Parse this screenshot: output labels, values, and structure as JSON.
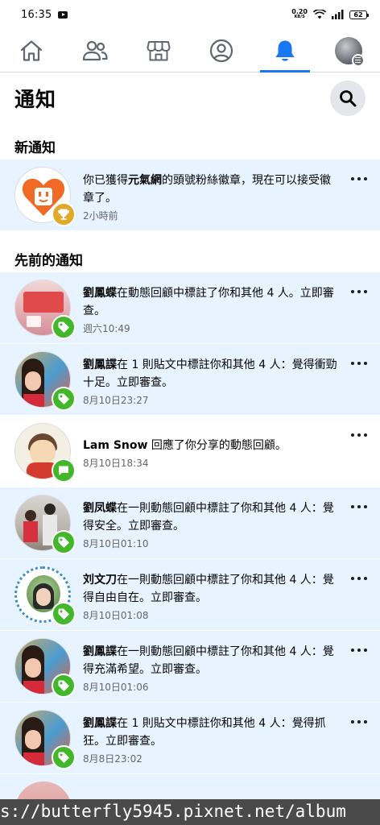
{
  "status_bar": {
    "time": "16:35",
    "net_speed": "0.20",
    "net_unit": "KB/S",
    "battery": "62"
  },
  "tabs": [
    {
      "name": "home",
      "icon": "home-icon",
      "active": false
    },
    {
      "name": "friends",
      "icon": "friends-icon",
      "active": false
    },
    {
      "name": "marketplace",
      "icon": "store-icon",
      "active": false
    },
    {
      "name": "profile",
      "icon": "profile-icon",
      "active": false
    },
    {
      "name": "notifications",
      "icon": "bell-icon",
      "active": true
    },
    {
      "name": "menu",
      "icon": "menu-avatar-icon",
      "active": false
    }
  ],
  "colors": {
    "accent": "#1877f2",
    "unread_bg": "#e7f3ff",
    "badge_green": "#42b72a",
    "badge_gold": "#e1a82a",
    "secondary_text": "#65676b"
  },
  "header": {
    "title": "通知"
  },
  "sections": {
    "new": "新通知",
    "earlier": "先前的通知"
  },
  "notifications": [
    {
      "pre": "你已獲得",
      "bold": "元氣網",
      "post": "的頭號粉絲徽章，現在可以接受徽章了。",
      "time": "2小時前",
      "badge": "trophy-icon",
      "unread": true
    },
    {
      "pre": "",
      "bold": "劉鳳蝶",
      "post": "在動態回顧中標註了你和其他 4 人。立即審查。",
      "time": "週六10:49",
      "badge": "tag-icon",
      "unread": true
    },
    {
      "pre": "",
      "bold": "劉鳳諜",
      "post": "在 1 則貼文中標註你和其他 4 人：覺得衝勁十足。立即審查。",
      "time": "8月10日23:27",
      "badge": "tag-icon",
      "unread": true
    },
    {
      "pre": "",
      "bold": "Lam Snow",
      "post": " 回應了你分享的動態回顧。",
      "time": "8月10日18:34",
      "badge": "comment-icon",
      "unread": false
    },
    {
      "pre": "",
      "bold": "劉凤蝶",
      "post": "在一則動態回顧中標註了你和其他 4 人：覺得安全。立即審查。",
      "time": "8月10日01:10",
      "badge": "tag-icon",
      "unread": true
    },
    {
      "pre": "",
      "bold": "刘文刀",
      "post": "在一則動態回顧中標註了你和其他 4 人：覺得自由自在。立即審查。",
      "time": "8月10日01:08",
      "badge": "tag-icon",
      "unread": true
    },
    {
      "pre": "",
      "bold": "劉鳳諜",
      "post": "在一則動態回顧中標註了你和其他 4 人：覺得充滿希望。立即審查。",
      "time": "8月10日01:06",
      "badge": "tag-icon",
      "unread": true
    },
    {
      "pre": "",
      "bold": "劉鳳諜",
      "post": "在 1 則貼文中標註你和其他 4 人：覺得抓狂。立即審查。",
      "time": "8月8日23:02",
      "badge": "tag-icon",
      "unread": true
    }
  ],
  "watermark": "s://butterfly5945.pixnet.net/album"
}
